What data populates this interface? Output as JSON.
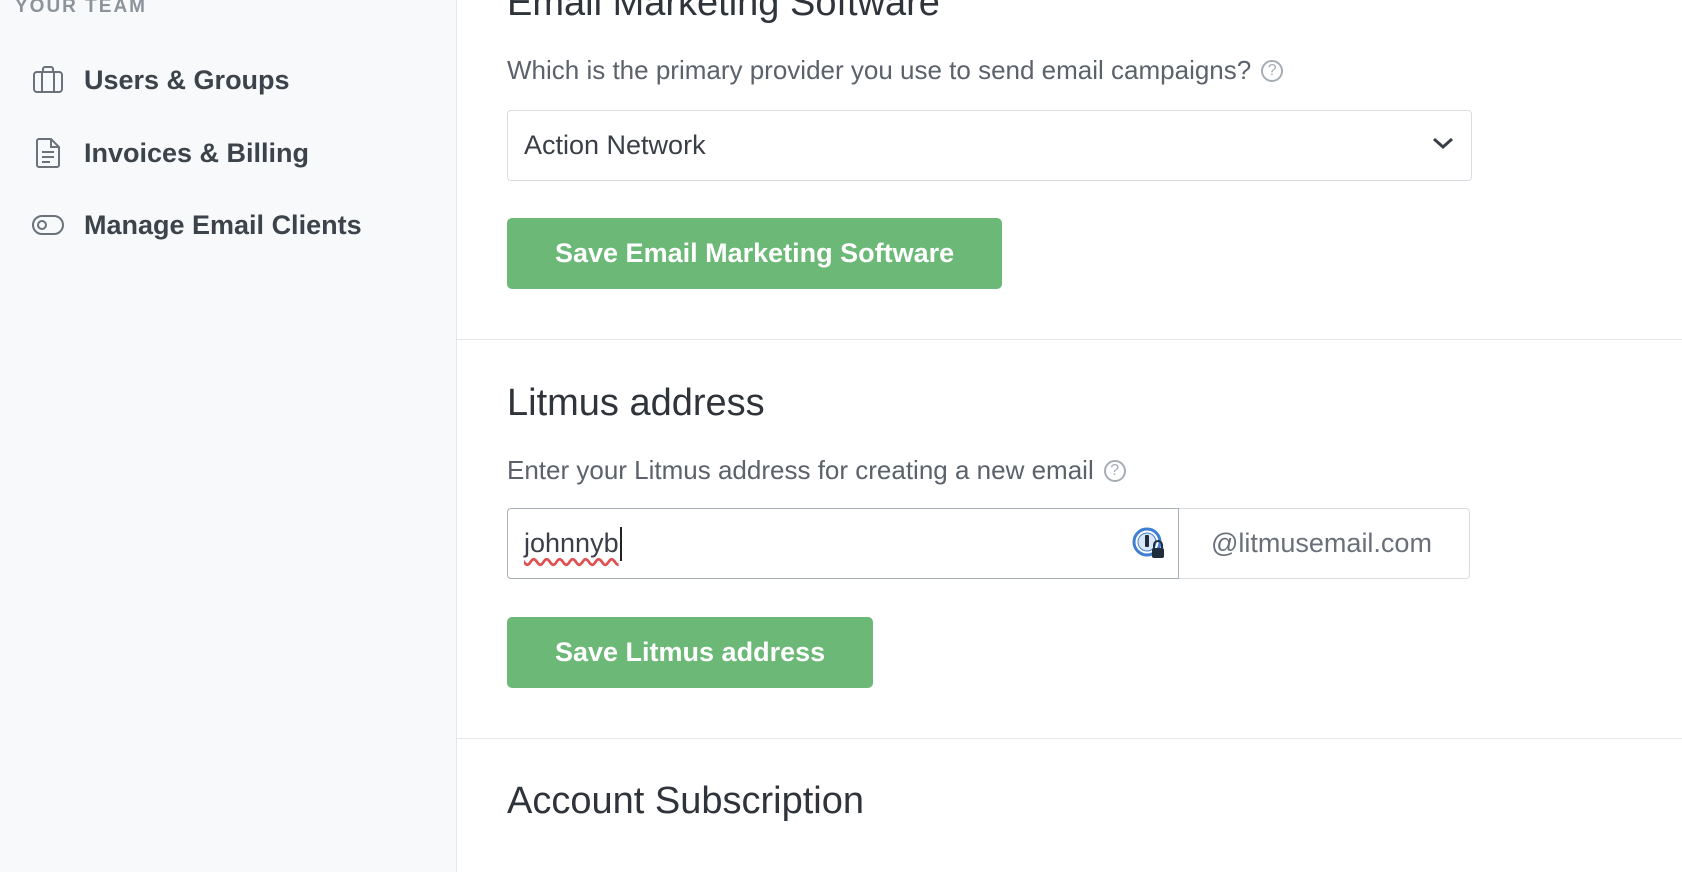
{
  "sidebar": {
    "heading": "YOUR TEAM",
    "items": [
      {
        "label": "Users & Groups",
        "icon": "briefcase-icon"
      },
      {
        "label": "Invoices & Billing",
        "icon": "document-icon"
      },
      {
        "label": "Manage Email Clients",
        "icon": "toggle-icon"
      }
    ]
  },
  "email_marketing": {
    "title": "Email Marketing Software",
    "question": "Which is the primary provider you use to send email campaigns?",
    "help": "?",
    "selected_provider": "Action Network",
    "save_label": "Save Email Marketing Software"
  },
  "litmus": {
    "title": "Litmus address",
    "question": "Enter your Litmus address for creating a new email",
    "help": "?",
    "input_value": "johnnyb",
    "domain_suffix": "@litmusemail.com",
    "save_label": "Save Litmus address"
  },
  "subscription": {
    "title": "Account Subscription"
  },
  "colors": {
    "button_green": "#6cb877",
    "sidebar_bg": "#f7f9fb"
  }
}
